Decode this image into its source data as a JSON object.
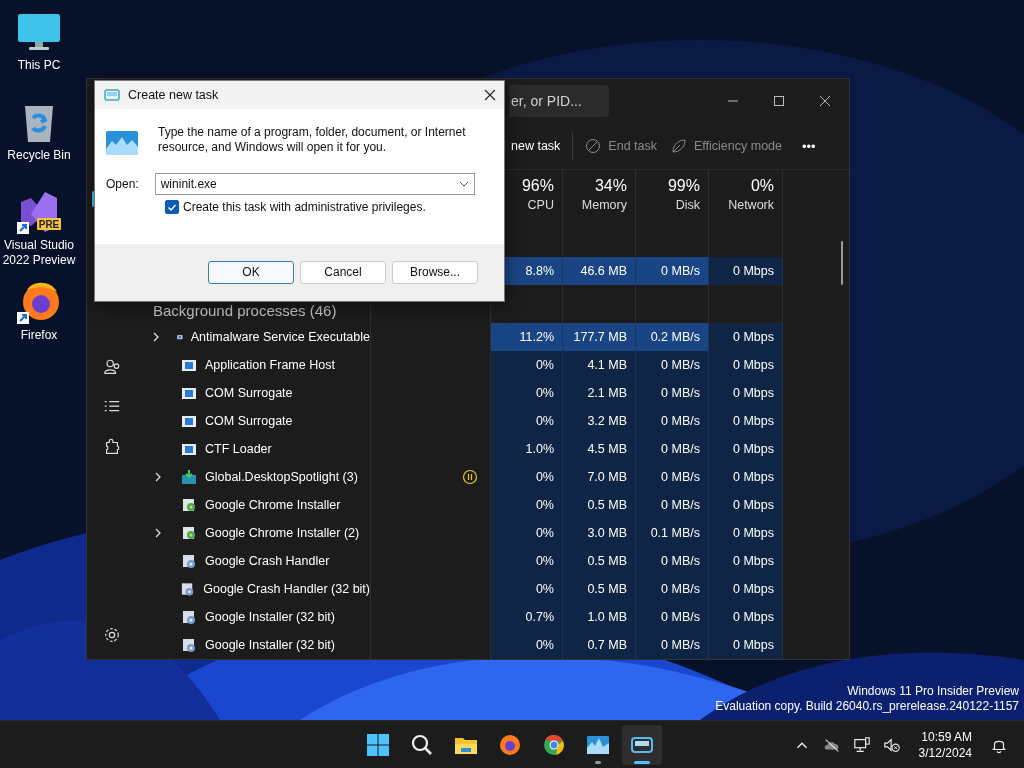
{
  "desktop_icons": [
    {
      "label": "This PC",
      "kind": "pc"
    },
    {
      "label": "Recycle Bin",
      "kind": "bin"
    },
    {
      "label": "Visual Studio 2022 Preview",
      "kind": "vs",
      "badge": "PRE",
      "shortcut": true
    },
    {
      "label": "Firefox",
      "kind": "firefox",
      "shortcut": true
    }
  ],
  "task_manager": {
    "search": {
      "placeholder": "er, or PID..."
    },
    "toolbar": [
      {
        "label": "new task",
        "kind": "run",
        "disabled": false
      },
      {
        "label": "End task",
        "kind": "end",
        "disabled": true
      },
      {
        "label": "Efficiency mode",
        "kind": "efficiency",
        "disabled": true
      },
      {
        "label": "•••",
        "kind": "more",
        "disabled": false
      }
    ],
    "nav": [
      {
        "kind": "processes",
        "selected": true
      },
      {
        "kind": "users",
        "selected": false
      },
      {
        "kind": "details",
        "selected": false
      },
      {
        "kind": "services",
        "selected": false
      },
      {
        "kind": "settings",
        "selected": false
      }
    ],
    "columns": [
      {
        "total": "96%",
        "label": "CPU"
      },
      {
        "total": "34%",
        "label": "Memory"
      },
      {
        "total": "99%",
        "label": "Disk"
      },
      {
        "total": "0%",
        "label": "Network"
      }
    ],
    "app_rows": [
      {
        "cpu": "8.8%",
        "memory": "46.6 MB",
        "disk": "0 MB/s",
        "network": "0 Mbps",
        "highlight": true
      }
    ],
    "background": {
      "title": "Background processes (46)",
      "rows": [
        {
          "name": "Antimalware Service Executable",
          "kind": "exe",
          "expandable": true,
          "suspended": false,
          "highlight": true,
          "cpu": "11.2%",
          "memory": "177.7 MB",
          "disk": "0.2 MB/s",
          "network": "0 Mbps"
        },
        {
          "name": "Application Frame Host",
          "kind": "exe",
          "expandable": false,
          "suspended": false,
          "highlight": false,
          "cpu": "0%",
          "memory": "4.1 MB",
          "disk": "0 MB/s",
          "network": "0 Mbps"
        },
        {
          "name": "COM Surrogate",
          "kind": "exe",
          "expandable": false,
          "suspended": false,
          "highlight": false,
          "cpu": "0%",
          "memory": "2.1 MB",
          "disk": "0 MB/s",
          "network": "0 Mbps"
        },
        {
          "name": "COM Surrogate",
          "kind": "exe",
          "expandable": false,
          "suspended": false,
          "highlight": false,
          "cpu": "0%",
          "memory": "3.2 MB",
          "disk": "0 MB/s",
          "network": "0 Mbps"
        },
        {
          "name": "CTF Loader",
          "kind": "exe",
          "expandable": false,
          "suspended": false,
          "highlight": false,
          "cpu": "1.0%",
          "memory": "4.5 MB",
          "disk": "0 MB/s",
          "network": "0 Mbps"
        },
        {
          "name": "Global.DesktopSpotlight (3)",
          "kind": "package",
          "expandable": true,
          "suspended": true,
          "highlight": false,
          "cpu": "0%",
          "memory": "7.0 MB",
          "disk": "0 MB/s",
          "network": "0 Mbps"
        },
        {
          "name": "Google Chrome Installer",
          "kind": "installer",
          "expandable": false,
          "suspended": false,
          "highlight": false,
          "cpu": "0%",
          "memory": "0.5 MB",
          "disk": "0 MB/s",
          "network": "0 Mbps"
        },
        {
          "name": "Google Chrome Installer (2)",
          "kind": "installer",
          "expandable": true,
          "suspended": false,
          "highlight": false,
          "cpu": "0%",
          "memory": "3.0 MB",
          "disk": "0.1 MB/s",
          "network": "0 Mbps"
        },
        {
          "name": "Google Crash Handler",
          "kind": "setup",
          "expandable": false,
          "suspended": false,
          "highlight": false,
          "cpu": "0%",
          "memory": "0.5 MB",
          "disk": "0 MB/s",
          "network": "0 Mbps"
        },
        {
          "name": "Google Crash Handler (32 bit)",
          "kind": "setup",
          "expandable": false,
          "suspended": false,
          "highlight": false,
          "cpu": "0%",
          "memory": "0.5 MB",
          "disk": "0 MB/s",
          "network": "0 Mbps"
        },
        {
          "name": "Google Installer (32 bit)",
          "kind": "setup",
          "expandable": false,
          "suspended": false,
          "highlight": false,
          "cpu": "0.7%",
          "memory": "1.0 MB",
          "disk": "0 MB/s",
          "network": "0 Mbps"
        },
        {
          "name": "Google Installer (32 bit)",
          "kind": "setup",
          "expandable": false,
          "suspended": false,
          "highlight": false,
          "cpu": "0%",
          "memory": "0.7 MB",
          "disk": "0 MB/s",
          "network": "0 Mbps"
        }
      ]
    }
  },
  "dialog": {
    "title": "Create new task",
    "message": "Type the name of a program, folder, document, or Internet resource, and Windows will open it for you.",
    "open_label": "Open:",
    "value": "wininit.exe",
    "admin": {
      "label": "Create this task with administrative privileges.",
      "checked": true
    },
    "buttons": [
      {
        "label": "OK",
        "default": true
      },
      {
        "label": "Cancel",
        "default": false
      },
      {
        "label": "Browse...",
        "default": false
      }
    ]
  },
  "evaluation_notice": [
    "Windows 11 Pro Insider Preview",
    "Evaluation copy. Build 26040.rs_prerelease.240122-1157"
  ],
  "taskbar": {
    "apps": [
      {
        "kind": "start",
        "running": false,
        "active": false
      },
      {
        "kind": "search",
        "running": false,
        "active": false
      },
      {
        "kind": "explorer",
        "running": false,
        "active": false
      },
      {
        "kind": "firefox",
        "running": false,
        "active": false
      },
      {
        "kind": "chrome",
        "running": false,
        "active": false
      },
      {
        "kind": "taskmgr",
        "running": true,
        "active": false
      },
      {
        "kind": "run",
        "running": true,
        "active": true
      }
    ],
    "tray": [
      {
        "kind": "chevron"
      },
      {
        "kind": "cloud"
      },
      {
        "kind": "network"
      },
      {
        "kind": "volume"
      }
    ],
    "clock": {
      "time": "10:59 AM",
      "date": "3/12/2024"
    }
  }
}
